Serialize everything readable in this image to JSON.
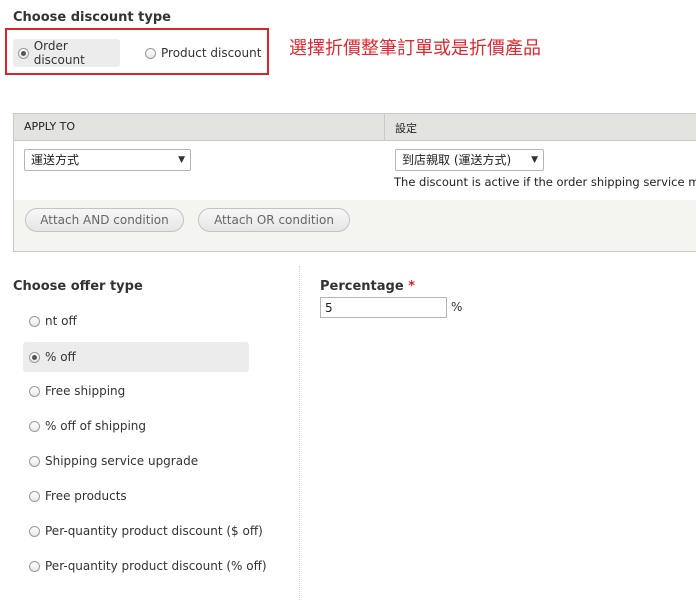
{
  "discount_type": {
    "heading": "Choose discount type",
    "options": [
      {
        "label": "Order discount",
        "checked": true
      },
      {
        "label": "Product discount",
        "checked": false
      }
    ],
    "annotation": "選擇折價整筆訂單或是折價產品"
  },
  "conditions": {
    "columns": [
      "APPLY TO",
      "設定"
    ],
    "apply_to_value": "運送方式",
    "setting_value": "到店親取 (運送方式)",
    "description": "The discount is active if the order shipping service match",
    "buttons": [
      "Attach AND condition",
      "Attach OR condition"
    ]
  },
  "offer_type": {
    "heading": "Choose offer type",
    "options": [
      {
        "label": "nt off",
        "checked": false
      },
      {
        "label": "% off",
        "checked": true
      },
      {
        "label": "Free shipping",
        "checked": false
      },
      {
        "label": "% off of shipping",
        "checked": false
      },
      {
        "label": "Shipping service upgrade",
        "checked": false
      },
      {
        "label": "Free products",
        "checked": false
      },
      {
        "label": "Per-quantity product discount ($ off)",
        "checked": false
      },
      {
        "label": "Per-quantity product discount (% off)",
        "checked": false
      }
    ]
  },
  "percentage": {
    "label": "Percentage",
    "required_mark": "*",
    "value": "5",
    "unit": "%"
  },
  "colors": {
    "annotation_red": "#e0282e",
    "selected_bg": "#ececec"
  }
}
